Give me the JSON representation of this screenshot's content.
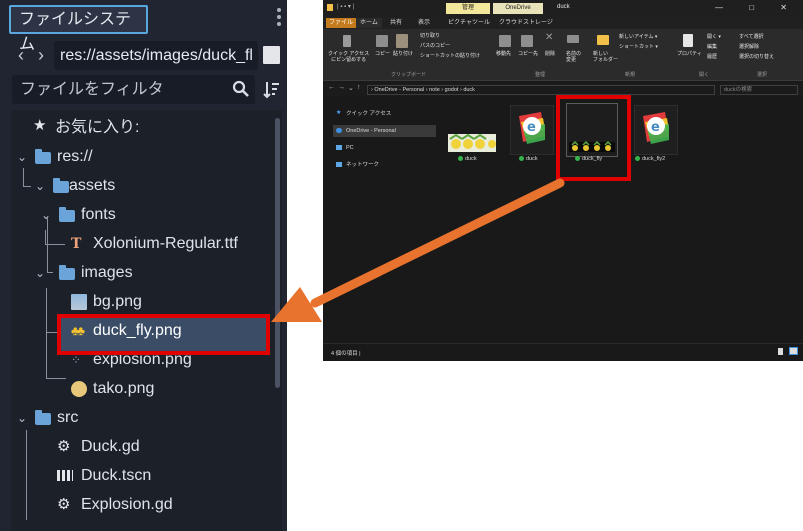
{
  "dock": {
    "title": "ファイルシステム",
    "nav_back": "‹",
    "nav_forward": "›",
    "path_value": "res://assets/images/duck_fl",
    "filter_placeholder": "ファイルをフィルタ",
    "tree": [
      {
        "id": "favorites",
        "label": "お気に入り:"
      },
      {
        "id": "res",
        "label": "res://"
      },
      {
        "id": "assets",
        "label": "assets"
      },
      {
        "id": "fonts",
        "label": "fonts"
      },
      {
        "id": "xolonium",
        "label": "Xolonium-Regular.ttf"
      },
      {
        "id": "images",
        "label": "images"
      },
      {
        "id": "bg",
        "label": "bg.png"
      },
      {
        "id": "duck_fly",
        "label": "duck_fly.png"
      },
      {
        "id": "explosion",
        "label": "explosion.png"
      },
      {
        "id": "tako",
        "label": "tako.png"
      },
      {
        "id": "src",
        "label": "src"
      },
      {
        "id": "duck_gd",
        "label": "Duck.gd"
      },
      {
        "id": "duck_tscn",
        "label": "Duck.tscn"
      },
      {
        "id": "explosion_gd",
        "label": "Explosion.gd"
      }
    ],
    "selected_item": "duck_fly"
  },
  "explorer": {
    "window_title": "duck",
    "context_tabs": [
      "管理",
      "OneDrive"
    ],
    "window_controls": "—  □  ✕",
    "ribbon_tabs": [
      "ファイル",
      "ホーム",
      "共有",
      "表示",
      "ピクチャツール",
      "クラウドストレージ"
    ],
    "ribbon": {
      "pin": "クイック アクセス\nにピン留めする",
      "copy": "コピー",
      "paste": "貼り付け",
      "cut": "切り取り",
      "copy_path": "パスのコピー",
      "paste_shortcut": "ショートカットの貼り付け",
      "move_to": "移動先",
      "copy_to": "コピー先",
      "delete": "削除",
      "rename": "名前の\n変更",
      "new_folder": "新しい\nフォルダー",
      "new_item": "新しいアイテム ▾",
      "shortcut": "ショートカット ▾",
      "properties": "プロパティ",
      "open": "開く ▾",
      "edit": "編集",
      "history": "履歴",
      "select_all": "すべて選択",
      "select_none": "選択解除",
      "invert_selection": "選択の切り替え",
      "group_clipboard": "クリップボード",
      "group_organize": "整理",
      "group_new": "新規",
      "group_open": "開く",
      "group_select": "選択"
    },
    "breadcrumb": "›  OneDrive - Personal  ›  note  ›  godot  ›  duck",
    "search_placeholder": "duckの検索",
    "nav_items": [
      "クイック アクセス",
      "OneDrive - Personal",
      "PC",
      "ネットワーク"
    ],
    "nav_selected": "OneDrive - Personal",
    "files": [
      "duck",
      "duck",
      "duck_fly",
      "duck_fly2"
    ],
    "selected_file": "duck_fly",
    "status_text": "4 個の項目  |"
  },
  "colors": {
    "highlight_box": "#e00000",
    "arrow": "#e8732e",
    "folder": "#6ba4d8",
    "dock_bg": "#202531"
  }
}
